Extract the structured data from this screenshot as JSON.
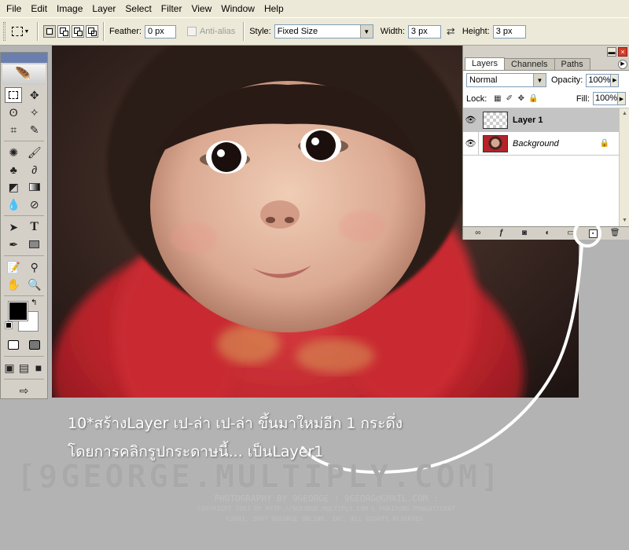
{
  "menu": [
    "File",
    "Edit",
    "Image",
    "Layer",
    "Select",
    "Filter",
    "View",
    "Window",
    "Help"
  ],
  "options": {
    "feather_label": "Feather:",
    "feather_value": "0 px",
    "antialias_label": "Anti-alias",
    "style_label": "Style:",
    "style_value": "Fixed Size",
    "width_label": "Width:",
    "width_value": "3 px",
    "height_label": "Height:",
    "height_value": "3 px"
  },
  "layers_panel": {
    "tabs": [
      "Layers",
      "Channels",
      "Paths"
    ],
    "blend_mode": "Normal",
    "opacity_label": "Opacity:",
    "opacity_value": "100%",
    "lock_label": "Lock:",
    "fill_label": "Fill:",
    "fill_value": "100%",
    "layers": [
      {
        "name": "Layer 1",
        "selected": true
      },
      {
        "name": "Background",
        "selected": false
      }
    ]
  },
  "annotation": {
    "line1": "10*สร้างLayer เป-ล่า เป-ล่า ขึ้นมาใหม่อีก 1 กระดึ่ง",
    "line2": "โดยการคลิกรูปกระดาษนี้... เป็นLayer1"
  },
  "watermark": {
    "main": "[9GEORGE.MULTIPLY.COM]",
    "line1": "PHOTOGRAPHY BY 9GEORGE : 9GEORG@GMAIL.COM :",
    "line2": "COPYRIGHT 2007 BY  HTTP://9GEORGE.MULTIPLY.COM L.PHAIPONG PONGATICHAT",
    "line3": "©2001, 2007 9GEORGE ONLINE, INC. ALL RIGHTS RESERVED."
  },
  "colors": {
    "ui_gray": "#d4d0c8",
    "xp_beige": "#ece9d8",
    "background": "#b3b3b3",
    "fg_color": "#000000",
    "bg_color": "#ffffff"
  }
}
